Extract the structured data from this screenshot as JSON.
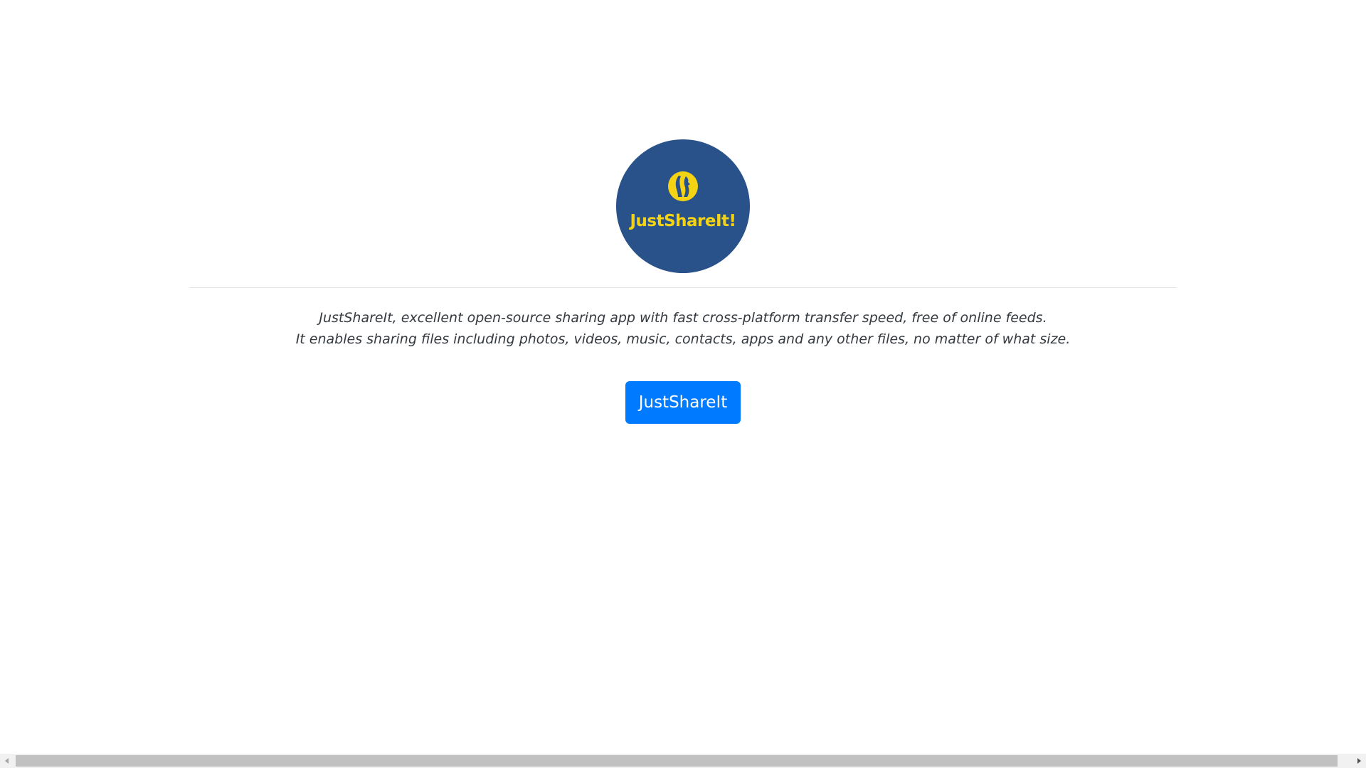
{
  "logo": {
    "text": "JustShareIt!",
    "icon": "justshareit-logo-icon",
    "background_color": "#2a528a",
    "text_color": "#f3d314"
  },
  "description": {
    "line1": "JustShareIt, excellent open-source sharing app with fast cross-platform transfer speed, free of online feeds.",
    "line2": "It enables sharing files including photos, videos, music, contacts, apps and any other files, no matter of what size."
  },
  "button": {
    "label": "JustShareIt",
    "color": "#007bff"
  }
}
